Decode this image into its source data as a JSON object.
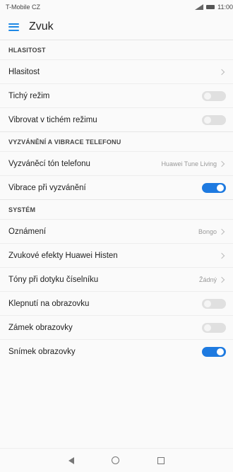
{
  "status_bar": {
    "carrier": "T-Mobile CZ",
    "time": "11:00"
  },
  "header": {
    "title": "Zvuk"
  },
  "sections": [
    {
      "title": "HLASITOST",
      "rows": [
        {
          "label": "Hlasitost",
          "type": "chevron"
        },
        {
          "label": "Tichý režim",
          "type": "toggle",
          "on": false
        },
        {
          "label": "Vibrovat v tichém režimu",
          "type": "toggle",
          "on": false
        }
      ]
    },
    {
      "title": "VYZVÁNĚNÍ A VIBRACE TELEFONU",
      "rows": [
        {
          "label": "Vyzváněcí tón telefonu",
          "type": "value",
          "value": "Huawei Tune Living"
        },
        {
          "label": "Vibrace při vyzvánění",
          "type": "toggle",
          "on": true
        }
      ]
    },
    {
      "title": "SYSTÉM",
      "rows": [
        {
          "label": "Oznámení",
          "type": "value",
          "value": "Bongo"
        },
        {
          "label": "Zvukové efekty Huawei Histen",
          "type": "chevron"
        },
        {
          "label": "Tóny při dotyku číselníku",
          "type": "value",
          "value": "Žádný"
        },
        {
          "label": "Klepnutí na obrazovku",
          "type": "toggle",
          "on": false
        },
        {
          "label": "Zámek obrazovky",
          "type": "toggle",
          "on": false
        },
        {
          "label": "Snímek obrazovky",
          "type": "toggle",
          "on": true
        }
      ]
    }
  ],
  "colors": {
    "accent": "#1e7ae0",
    "toggle_off": "#e0e0e0"
  }
}
